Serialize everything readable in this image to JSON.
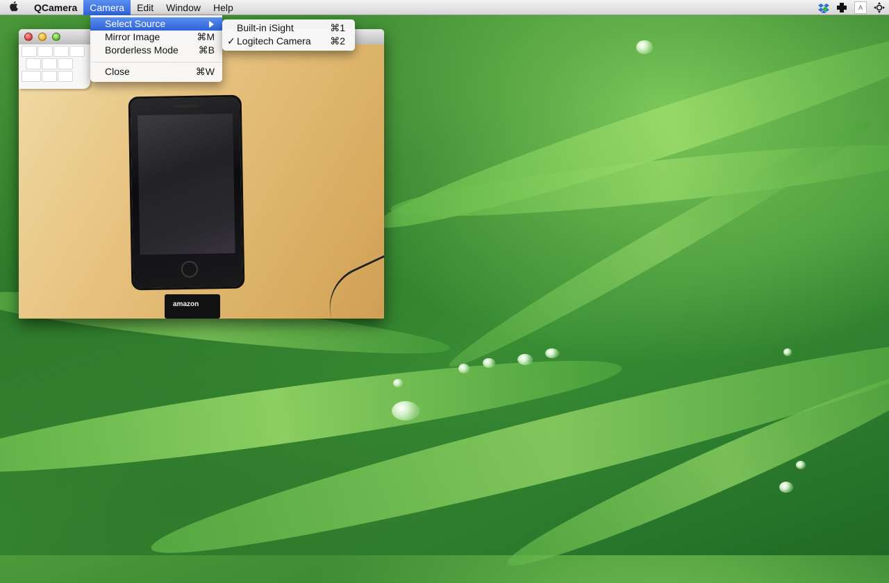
{
  "menubar": {
    "apple_icon": "apple-logo",
    "app_name": "QCamera",
    "items": [
      "Camera",
      "Edit",
      "Window",
      "Help"
    ],
    "active_item": "Camera"
  },
  "status_icons": [
    "dropbox-icon",
    "plus-cross-icon",
    "input-source-icon",
    "move-arrows-icon"
  ],
  "status_icon_text": {
    "input_source": "A"
  },
  "camera_menu": {
    "items": [
      {
        "label": "Select Source",
        "shortcut": "",
        "submenu": true,
        "highlighted": true
      },
      {
        "label": "Mirror Image",
        "shortcut": "⌘M"
      },
      {
        "label": "Borderless Mode",
        "shortcut": "⌘B"
      },
      {
        "label": "Close",
        "shortcut": "⌘W"
      }
    ]
  },
  "source_submenu": {
    "items": [
      {
        "label": "Built-in iSight",
        "shortcut": "⌘1",
        "checked": false
      },
      {
        "label": "Logitech Camera",
        "shortcut": "⌘2",
        "checked": true
      }
    ],
    "check_glyph": "✓"
  },
  "camera_feed": {
    "dock_label": "amazon"
  },
  "colors": {
    "highlight": "#2d63d8",
    "desktop": "#3a8f35"
  }
}
